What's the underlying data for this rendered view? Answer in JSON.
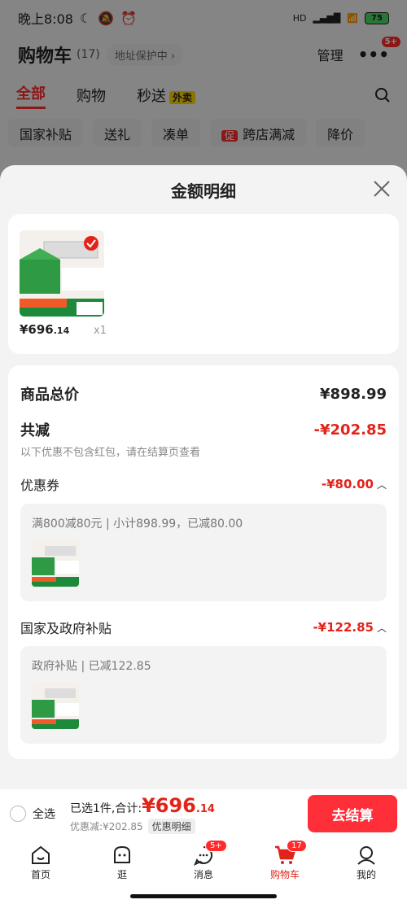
{
  "status": {
    "time": "晚上8:08",
    "battery": "75",
    "network": "HD"
  },
  "header": {
    "title": "购物车",
    "count": "(17)",
    "address": "地址保护中 ›",
    "manage": "管理",
    "more_badge": "5+"
  },
  "tabs": [
    {
      "label": "全部"
    },
    {
      "label": "购物"
    },
    {
      "label": "秒送",
      "tag": "外卖"
    }
  ],
  "chips": [
    "国家补贴",
    "送礼",
    "凑单",
    "跨店满减",
    "降价"
  ],
  "chip_tag": "促",
  "sheet": {
    "title": "金额明细",
    "product": {
      "price_main": "¥696",
      "price_dec": ".14",
      "qty": "x1"
    },
    "total_label": "商品总价",
    "total_value": "¥898.99",
    "reduce_label": "共减",
    "reduce_value": "-¥202.85",
    "reduce_note": "以下优惠不包含红包，请在结算页查看",
    "coupon_label": "优惠券",
    "coupon_value": "-¥80.00",
    "coupon_detail": "满800减80元 | 小计898.99，已减80.00",
    "subsidy_label": "国家及政府补贴",
    "subsidy_value": "-¥122.85",
    "subsidy_detail": "政府补贴 | 已减122.85"
  },
  "bottom": {
    "select_all": "全选",
    "selected": "已选1件,合计:",
    "price_main": "¥696",
    "price_dec": ".14",
    "discount": "优惠减:¥202.85",
    "detail_btn": "优惠明细",
    "checkout": "去结算"
  },
  "nav": [
    {
      "label": "首页",
      "badge": ""
    },
    {
      "label": "逛",
      "badge": ""
    },
    {
      "label": "消息",
      "badge": "5+"
    },
    {
      "label": "购物车",
      "badge": "17"
    },
    {
      "label": "我的",
      "badge": ""
    }
  ],
  "colors": {
    "accent": "#e2231a",
    "checkout": "#ff2f3a"
  }
}
